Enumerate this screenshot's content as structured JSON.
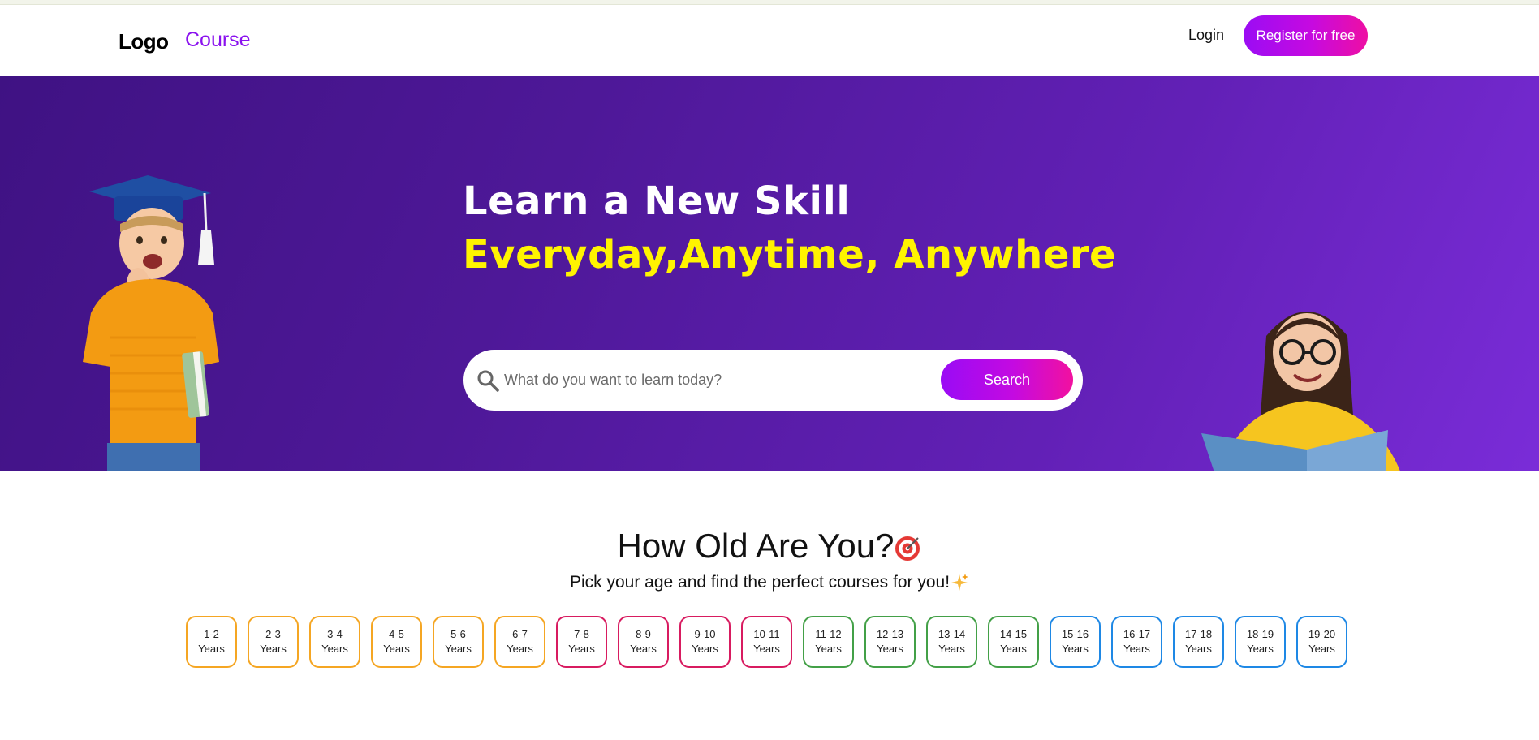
{
  "header": {
    "logo": "Logo",
    "nav_course": "Course",
    "login": "Login",
    "register": "Register for free"
  },
  "hero": {
    "headline": "Learn a New Skill",
    "subline": "Everyday,Anytime, Anywhere",
    "search": {
      "placeholder": "What do you want to learn today?",
      "button": "Search"
    }
  },
  "age_section": {
    "title": "How Old Are You?",
    "title_emoji": "target-icon",
    "subtitle": "Pick your age and find the perfect courses for you!",
    "subtitle_emoji": "sparkles-icon",
    "chips": [
      {
        "range": "1-2",
        "unit": "Years",
        "color": "#f5a623"
      },
      {
        "range": "2-3",
        "unit": "Years",
        "color": "#f5a623"
      },
      {
        "range": "3-4",
        "unit": "Years",
        "color": "#f5a623"
      },
      {
        "range": "4-5",
        "unit": "Years",
        "color": "#f5a623"
      },
      {
        "range": "5-6",
        "unit": "Years",
        "color": "#f5a623"
      },
      {
        "range": "6-7",
        "unit": "Years",
        "color": "#f5a623"
      },
      {
        "range": "7-8",
        "unit": "Years",
        "color": "#d81b60"
      },
      {
        "range": "8-9",
        "unit": "Years",
        "color": "#d81b60"
      },
      {
        "range": "9-10",
        "unit": "Years",
        "color": "#d81b60"
      },
      {
        "range": "10-11",
        "unit": "Years",
        "color": "#d81b60"
      },
      {
        "range": "11-12",
        "unit": "Years",
        "color": "#43a047"
      },
      {
        "range": "12-13",
        "unit": "Years",
        "color": "#43a047"
      },
      {
        "range": "13-14",
        "unit": "Years",
        "color": "#43a047"
      },
      {
        "range": "14-15",
        "unit": "Years",
        "color": "#43a047"
      },
      {
        "range": "15-16",
        "unit": "Years",
        "color": "#1e88e5"
      },
      {
        "range": "16-17",
        "unit": "Years",
        "color": "#1e88e5"
      },
      {
        "range": "17-18",
        "unit": "Years",
        "color": "#1e88e5"
      },
      {
        "range": "18-19",
        "unit": "Years",
        "color": "#1e88e5"
      },
      {
        "range": "19-20",
        "unit": "Years",
        "color": "#1e88e5"
      }
    ]
  }
}
